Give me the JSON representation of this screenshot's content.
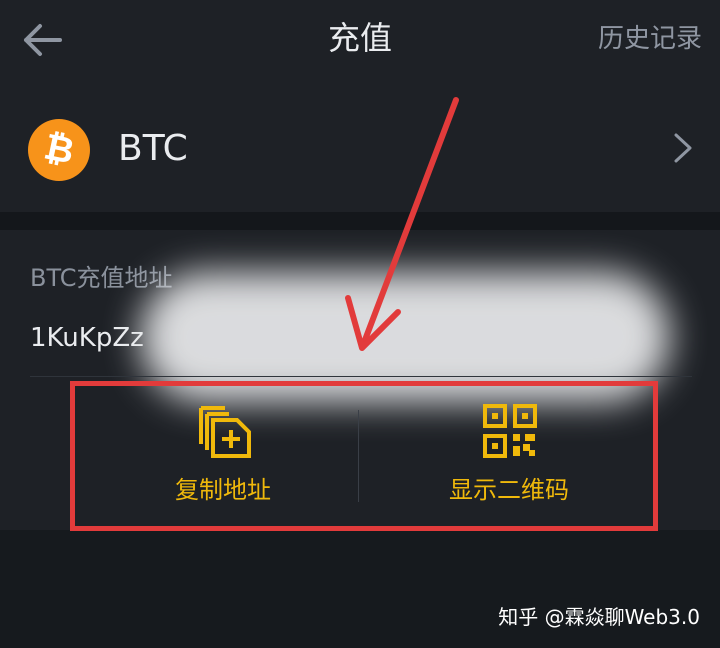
{
  "header": {
    "title": "充值",
    "history_label": "历史记录",
    "back_icon": "arrow-left-icon"
  },
  "coin": {
    "symbol": "BTC",
    "logo_glyph": "₿",
    "logo_color": "#f7931a",
    "chevron_icon": "chevron-right-icon"
  },
  "address": {
    "label": "BTC充值地址",
    "value": "1KuKpZz"
  },
  "actions": {
    "copy_label": "复制地址",
    "copy_icon": "copy-add-icon",
    "qr_label": "显示二维码",
    "qr_icon": "qr-code-icon",
    "accent_color": "#f0b90b"
  },
  "annotation": {
    "color": "#e23b3b"
  },
  "watermark": {
    "text": "知乎 @霖焱聊Web3.0"
  }
}
